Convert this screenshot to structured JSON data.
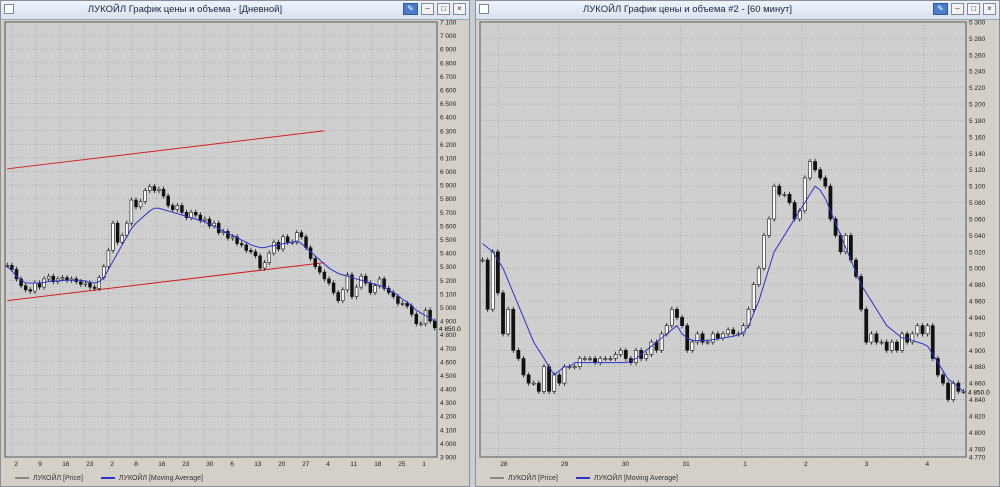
{
  "windows": [
    {
      "title": "ЛУКОЙЛ График цены и объема - [Дневной]",
      "legend": [
        "ЛУКОЙЛ [Price]",
        "ЛУКОЙЛ [Moving Average]"
      ]
    },
    {
      "title": "ЛУКОЙЛ График цены и объема #2 - [60 минут]",
      "legend": [
        "ЛУКОЙЛ [Price]",
        "ЛУКОЙЛ [Moving Average]"
      ]
    }
  ],
  "colors": {
    "price": "#111111",
    "moving_average": "#2a35c8",
    "channel": "#d02020",
    "grid": "#7a7a7a",
    "plot_bg": "#cfcfcf"
  },
  "chart_data": [
    {
      "type": "candlestick",
      "timeframe": "Дневной",
      "ylim": [
        3900,
        7100
      ],
      "yticks": [
        "7 100",
        "7 000",
        "6 900",
        "6 800",
        "6 700",
        "6 600",
        "6 500",
        "6 400",
        "6 300",
        "6 200",
        "6 100",
        "6 000",
        "5 900",
        "5 800",
        "5 700",
        "5 600",
        "5 500",
        "5 400",
        "5 300",
        "5 200",
        "5 100",
        "5 000",
        "4 900",
        "4 800",
        "4 700",
        "4 600",
        "4 500",
        "4 400",
        "4 300",
        "4 200",
        "4 100",
        "4 000",
        "3 900"
      ],
      "xticks": [
        "2",
        "9",
        "16",
        "23",
        "2",
        "8",
        "16",
        "23",
        "30",
        "6",
        "13",
        "20",
        "27",
        "4",
        "11",
        "18",
        "25",
        "1"
      ],
      "last_price_label": "4 850.0",
      "close": [
        5310,
        5280,
        5210,
        5160,
        5130,
        5120,
        5180,
        5150,
        5210,
        5230,
        5190,
        5210,
        5220,
        5200,
        5210,
        5190,
        5170,
        5180,
        5150,
        5140,
        5220,
        5300,
        5420,
        5620,
        5480,
        5530,
        5620,
        5790,
        5740,
        5780,
        5860,
        5890,
        5860,
        5870,
        5820,
        5750,
        5720,
        5750,
        5700,
        5660,
        5700,
        5680,
        5640,
        5650,
        5600,
        5620,
        5550,
        5560,
        5510,
        5520,
        5470,
        5460,
        5420,
        5410,
        5380,
        5290,
        5330,
        5400,
        5480,
        5430,
        5520,
        5480,
        5480,
        5550,
        5520,
        5440,
        5360,
        5300,
        5260,
        5210,
        5180,
        5110,
        5050,
        5130,
        5240,
        5080,
        5150,
        5230,
        5180,
        5110,
        5160,
        5210,
        5140,
        5110,
        5080,
        5030,
        5030,
        5010,
        4950,
        4880,
        4880,
        4980,
        4900,
        4850
      ],
      "ma": [
        5300,
        5270,
        5230,
        5200,
        5180,
        5180,
        5180,
        5180,
        5185,
        5190,
        5195,
        5195,
        5200,
        5200,
        5200,
        5200,
        5200,
        5195,
        5185,
        5180,
        5190,
        5220,
        5280,
        5340,
        5400,
        5460,
        5520,
        5580,
        5620,
        5650,
        5680,
        5710,
        5730,
        5730,
        5720,
        5710,
        5700,
        5690,
        5680,
        5670,
        5660,
        5650,
        5640,
        5630,
        5610,
        5600,
        5580,
        5560,
        5545,
        5530,
        5515,
        5495,
        5480,
        5460,
        5450,
        5440,
        5440,
        5450,
        5455,
        5460,
        5470,
        5475,
        5480,
        5490,
        5470,
        5440,
        5410,
        5380,
        5350,
        5320,
        5290,
        5270,
        5250,
        5240,
        5230,
        5220,
        5210,
        5200,
        5190,
        5180,
        5170,
        5160,
        5150,
        5130,
        5110,
        5090,
        5060,
        5040,
        5010,
        4980,
        4960,
        4940,
        4920,
        4900
      ],
      "channel_lines": [
        {
          "x": [
            0,
            69
          ],
          "y": [
            6020,
            6300
          ]
        },
        {
          "x": [
            0,
            69
          ],
          "y": [
            5050,
            5330
          ]
        }
      ],
      "series": [
        {
          "name": "ЛУКОЙЛ [Price]"
        },
        {
          "name": "ЛУКОЙЛ [Moving Average]"
        }
      ]
    },
    {
      "type": "candlestick",
      "timeframe": "60 минут",
      "ylim": [
        4770,
        5300
      ],
      "yticks": [
        "5 300",
        "5 280",
        "5 260",
        "5 240",
        "5 220",
        "5 200",
        "5 180",
        "5 160",
        "5 140",
        "5 120",
        "5 100",
        "5 080",
        "5 060",
        "5 040",
        "5 020",
        "5 000",
        "4 980",
        "4 960",
        "4 940",
        "4 920",
        "4 900",
        "4 880",
        "4 860",
        "4 840",
        "4 820",
        "4 800",
        "4 780",
        "4 770"
      ],
      "xticks": [
        "28",
        "29",
        "30",
        "31",
        "1",
        "2",
        "3",
        "4"
      ],
      "last_price_label": "4 850.0",
      "close": [
        5010,
        4950,
        5020,
        4970,
        4920,
        4950,
        4900,
        4890,
        4870,
        4860,
        4860,
        4850,
        4880,
        4850,
        4870,
        4860,
        4880,
        4880,
        4880,
        4890,
        4890,
        4890,
        4885,
        4890,
        4890,
        4890,
        4895,
        4900,
        4890,
        4885,
        4900,
        4890,
        4895,
        4910,
        4900,
        4920,
        4930,
        4950,
        4940,
        4930,
        4900,
        4910,
        4920,
        4910,
        4910,
        4920,
        4915,
        4920,
        4925,
        4920,
        4920,
        4930,
        4950,
        4980,
        5000,
        5040,
        5060,
        5100,
        5090,
        5090,
        5080,
        5060,
        5070,
        5110,
        5130,
        5120,
        5110,
        5100,
        5060,
        5040,
        5020,
        5040,
        5010,
        4990,
        4950,
        4910,
        4920,
        4910,
        4910,
        4900,
        4910,
        4900,
        4920,
        4910,
        4920,
        4930,
        4920,
        4930,
        4890,
        4870,
        4860,
        4840,
        4860,
        4850,
        4850
      ],
      "ma": [
        5030,
        5025,
        5020,
        5010,
        5000,
        4985,
        4970,
        4955,
        4940,
        4925,
        4910,
        4900,
        4890,
        4880,
        4870,
        4875,
        4880,
        4880,
        4885,
        4885,
        4885,
        4885,
        4885,
        4885,
        4885,
        4885,
        4885,
        4885,
        4885,
        4887,
        4890,
        4895,
        4900,
        4905,
        4910,
        4915,
        4920,
        4925,
        4930,
        4920,
        4915,
        4912,
        4912,
        4912,
        4912,
        4913,
        4914,
        4915,
        4916,
        4917,
        4919,
        4922,
        4930,
        4945,
        4960,
        4980,
        5000,
        5020,
        5030,
        5040,
        5050,
        5060,
        5070,
        5080,
        5090,
        5100,
        5095,
        5085,
        5070,
        5055,
        5040,
        5025,
        5010,
        4995,
        4980,
        4970,
        4960,
        4950,
        4940,
        4930,
        4925,
        4920,
        4915,
        4915,
        4912,
        4910,
        4908,
        4905,
        4895,
        4885,
        4875,
        4865,
        4860,
        4855,
        4850
      ],
      "series": [
        {
          "name": "ЛУКОЙЛ [Price]"
        },
        {
          "name": "ЛУКОЙЛ [Moving Average]"
        }
      ]
    }
  ]
}
